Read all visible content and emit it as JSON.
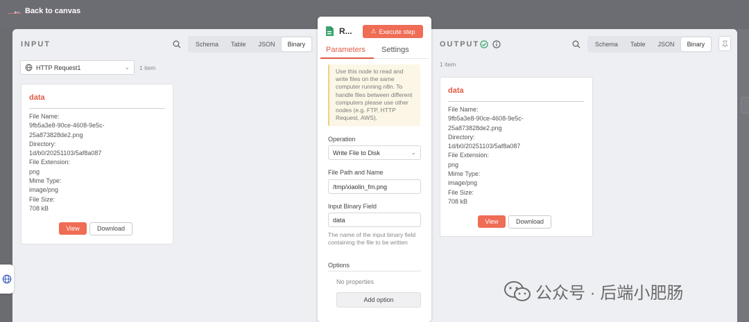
{
  "topbar": {
    "back_label": "Back to canvas"
  },
  "input": {
    "title": "INPUT",
    "tabs": [
      "Schema",
      "Table",
      "JSON",
      "Binary"
    ],
    "active_tab": "Binary",
    "source_node": "HTTP Request1",
    "item_count": "1 item",
    "card": {
      "title": "data",
      "file_name_label": "File Name:",
      "file_name_line1": "9fb5a3e8-90ce-4608-9e5c-",
      "file_name_line2": "25a873828de2.png",
      "directory_label": "Directory:",
      "directory": "1d/b0/20251103/5af8a087",
      "extension_label": "File Extension:",
      "extension": "png",
      "mime_label": "Mime Type:",
      "mime": "image/png",
      "size_label": "File Size:",
      "size": "708 kB",
      "view_label": "View",
      "download_label": "Download"
    }
  },
  "node": {
    "name": "R...",
    "execute_label": "Execute step",
    "tab_parameters": "Parameters",
    "tab_settings": "Settings",
    "notice": "Use this node to read and write files on the same computer running n8n. To handle files between different computers please use other nodes (e.g. FTP, HTTP Request, AWS).",
    "operation_label": "Operation",
    "operation_value": "Write File to Disk",
    "path_label": "File Path and Name",
    "path_value": "/tmp/xiaolin_fm.png",
    "binary_label": "Input Binary Field",
    "binary_value": "data",
    "binary_hint": "The name of the input binary field containing the file to be written",
    "options_label": "Options",
    "no_properties": "No properties",
    "add_option": "Add option"
  },
  "output": {
    "title": "OUTPUT",
    "tabs": [
      "Schema",
      "Table",
      "JSON",
      "Binary"
    ],
    "active_tab": "Binary",
    "item_count": "1 item",
    "card": {
      "title": "data",
      "file_name_label": "File Name:",
      "file_name_line1": "9fb5a3e8-90ce-4608-9e5c-",
      "file_name_line2": "25a873828de2.png",
      "directory_label": "Directory:",
      "directory": "1d/b0/20251103/5af8a087",
      "extension_label": "File Extension:",
      "extension": "png",
      "mime_label": "Mime Type:",
      "mime": "image/png",
      "size_label": "File Size:",
      "size": "708 kB",
      "view_label": "View",
      "download_label": "Download"
    }
  },
  "watermark": {
    "text": "公众号 · 后端小肥肠"
  },
  "colors": {
    "accent": "#ef6c55",
    "success": "#3aa56e",
    "notice_bg": "#fcf6e6"
  }
}
